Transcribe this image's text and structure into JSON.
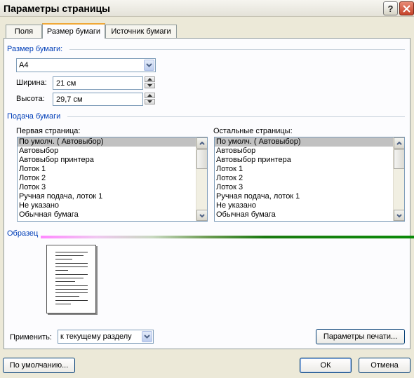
{
  "window": {
    "title": "Параметры страницы"
  },
  "titlebar": {
    "help_label": "?"
  },
  "tabs": [
    {
      "label": "Поля"
    },
    {
      "label": "Размер бумаги"
    },
    {
      "label": "Источник бумаги"
    }
  ],
  "paper_size": {
    "header": "Размер бумаги:",
    "selected": "A4",
    "width_label": "Ширина:",
    "width_value": "21 см",
    "height_label": "Высота:",
    "height_value": "29,7 см"
  },
  "paper_feed": {
    "header": "Подача бумаги",
    "first_page_label": "Первая страница:",
    "other_pages_label": "Остальные страницы:",
    "first_page_items": [
      "По умолч. ( Автовыбор)",
      "Автовыбор",
      "Автовыбор принтера",
      "Лоток 1",
      "Лоток 2",
      "Лоток 3",
      "Ручная подача, лоток 1",
      "Не указано",
      "Обычная бумага"
    ],
    "other_pages_items": [
      "По умолч. ( Автовыбор)",
      "Автовыбор",
      "Автовыбор принтера",
      "Лоток 1",
      "Лоток 2",
      "Лоток 3",
      "Ручная подача, лоток 1",
      "Не указано",
      "Обычная бумага"
    ]
  },
  "preview": {
    "header": "Образец"
  },
  "apply": {
    "label": "Применить:",
    "value": "к текущему разделу"
  },
  "buttons": {
    "print_options": "Параметры печати...",
    "default": "По умолчанию...",
    "ok": "ОК",
    "cancel": "Отмена"
  },
  "colors": {
    "accent_tab": "#f0a838",
    "group_header": "#003eb8",
    "selection": "#c1c1c1"
  }
}
